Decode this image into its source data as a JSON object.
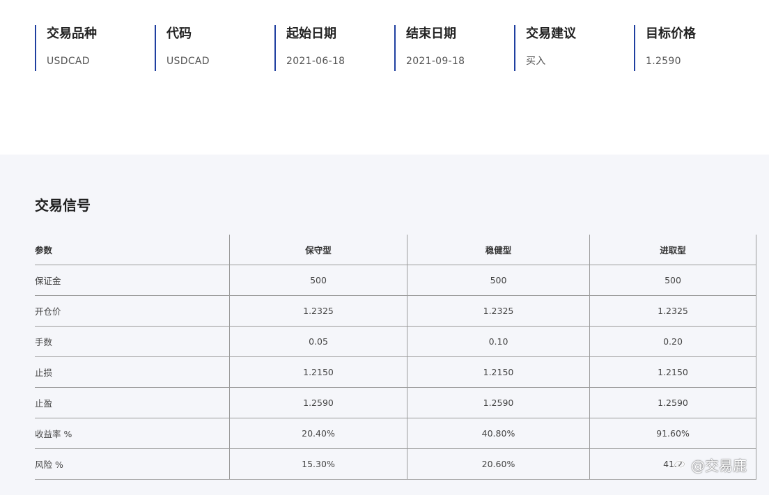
{
  "info": [
    {
      "label": "交易品种",
      "value": "USDCAD"
    },
    {
      "label": "代码",
      "value": "USDCAD"
    },
    {
      "label": "起始日期",
      "value": "2021-06-18"
    },
    {
      "label": "结束日期",
      "value": "2021-09-18"
    },
    {
      "label": "交易建议",
      "value": "买入"
    },
    {
      "label": "目标价格",
      "value": "1.2590"
    }
  ],
  "signal": {
    "title": "交易信号",
    "headers": [
      "参数",
      "保守型",
      "稳健型",
      "进取型"
    ],
    "rows": [
      [
        "保证金",
        "500",
        "500",
        "500"
      ],
      [
        "开仓价",
        "1.2325",
        "1.2325",
        "1.2325"
      ],
      [
        "手数",
        "0.05",
        "0.10",
        "0.20"
      ],
      [
        "止损",
        "1.2150",
        "1.2150",
        "1.2150"
      ],
      [
        "止盈",
        "1.2590",
        "1.2590",
        "1.2590"
      ],
      [
        "收益率 %",
        "20.40%",
        "40.80%",
        "91.60%"
      ],
      [
        "风险 %",
        "15.30%",
        "20.60%",
        "41.2"
      ]
    ]
  },
  "watermark": {
    "text": "@交易鹿",
    "icon": "brand-logo-icon"
  },
  "colors": {
    "accent": "#1f3fa0",
    "section_bg": "#f5f6fa",
    "border": "#9a9a9a"
  }
}
